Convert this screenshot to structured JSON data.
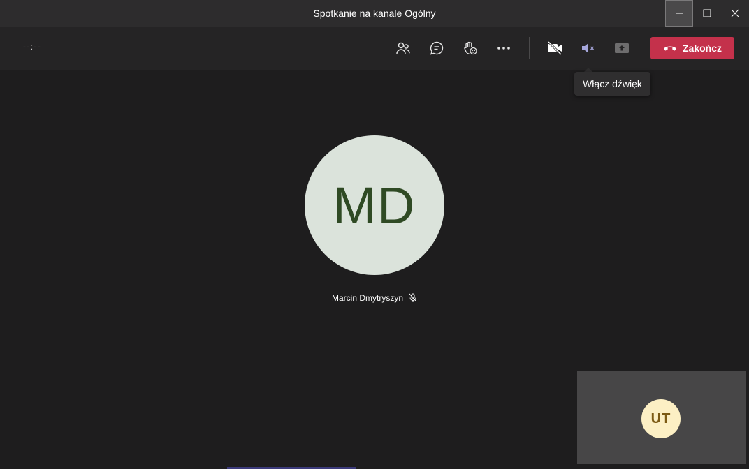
{
  "window": {
    "title": "Spotkanie na kanale Ogólny"
  },
  "toolbar": {
    "timer": "--:--",
    "hangup_label": "Zakończ",
    "tooltip": "Włącz dźwięk"
  },
  "stage": {
    "participant_initials": "MD",
    "participant_name": "Marcin Dmytryszyn"
  },
  "self_view": {
    "initials": "UT"
  },
  "colors": {
    "hangup": "#c4314b",
    "speaker_muted_accent": "#a6a7dc",
    "avatar_large_bg": "#dbe3db",
    "avatar_small_bg": "#fcefc4"
  },
  "icons": {
    "participants": "participants-icon",
    "chat": "chat-icon",
    "reactions": "raise-hand-icon",
    "more": "more-options-icon",
    "camera": "camera-off-icon",
    "speaker": "speaker-muted-icon",
    "share": "share-tray-icon",
    "hangup": "phone-hangup-icon",
    "mic": "mic-off-icon"
  }
}
